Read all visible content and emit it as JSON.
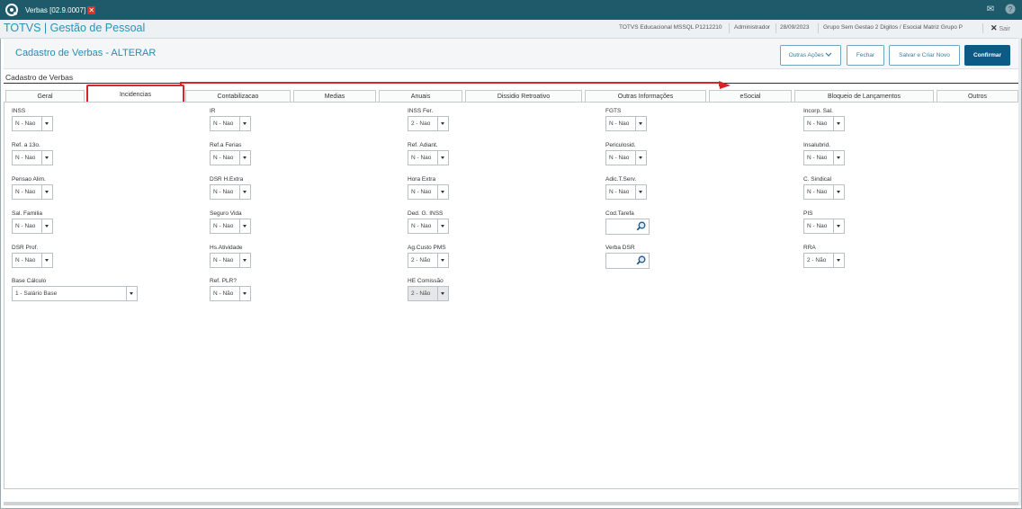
{
  "window": {
    "tab_label": "Verbas [02.9.0007]",
    "close_glyph": "✕"
  },
  "header": {
    "app_title": "TOTVS | Gestão de Pessoal",
    "environment": "TOTVS Educacional MSSQL P1212210",
    "user": "Administrador",
    "date": "28/09/2023",
    "company": "Grupo Sem Gestao 2 Digitos / Esocial Matriz Grupo Pf",
    "exit_label": "Sair"
  },
  "page": {
    "title": "Cadastro de Verbas - ALTERAR",
    "section_title": "Cadastro de Verbas",
    "actions": {
      "more_actions": "Outras Ações",
      "close": "Fechar",
      "save_new": "Salvar e Criar Novo",
      "confirm": "Confirmar"
    }
  },
  "tabs": [
    {
      "label": "Geral"
    },
    {
      "label": "Incidencias"
    },
    {
      "label": "Contabilizacao"
    },
    {
      "label": "Medias"
    },
    {
      "label": "Anuais"
    },
    {
      "label": "Dissidio Retroativo"
    },
    {
      "label": "Outras Informações"
    },
    {
      "label": "eSocial"
    },
    {
      "label": "Bloqueio de Lançamentos"
    },
    {
      "label": "Outros"
    }
  ],
  "fields": {
    "inss": {
      "label": "INSS",
      "value": "N - Nao"
    },
    "ir": {
      "label": "IR",
      "value": "N - Nao"
    },
    "inss_fer": {
      "label": "INSS Fer.",
      "value": "2 - Nao"
    },
    "fgts": {
      "label": "FGTS",
      "value": "N - Nao"
    },
    "incorp_sal": {
      "label": "Incorp. Sal.",
      "value": "N - Nao"
    },
    "ref_13": {
      "label": "Ref. a 13o.",
      "value": "N - Nao"
    },
    "ref_ferias": {
      "label": "Ref.a Ferias",
      "value": "N - Nao"
    },
    "ref_adiant": {
      "label": "Ref. Adiant.",
      "value": "N - Nao"
    },
    "periculosid": {
      "label": "Periculosid.",
      "value": "N - Nao"
    },
    "insalubrid": {
      "label": "Insalubrid.",
      "value": "N - Nao"
    },
    "pensao_alim": {
      "label": "Pensao Alim.",
      "value": "N - Nao"
    },
    "dsr_h_extra": {
      "label": "DSR H.Extra",
      "value": "N - Nao"
    },
    "hora_extra": {
      "label": "Hora Extra",
      "value": "N - Nao"
    },
    "adic_tserv": {
      "label": "Adic.T.Serv.",
      "value": "N - Nao"
    },
    "c_sindical": {
      "label": "C. Sindical",
      "value": "N - Nao"
    },
    "sal_familia": {
      "label": "Sal. Familia",
      "value": "N - Nao"
    },
    "seguro_vida": {
      "label": "Seguro Vida",
      "value": "N - Nao"
    },
    "ded_g_inss": {
      "label": "Ded. G. INSS",
      "value": "N - Nao"
    },
    "cod_tarefa": {
      "label": "Cod.Tarefa",
      "value": ""
    },
    "pis": {
      "label": "PIS",
      "value": "N - Nao"
    },
    "dsr_prof": {
      "label": "DSR Prof.",
      "value": "N - Nao"
    },
    "hs_atividade": {
      "label": "Hs.Atividade",
      "value": "N - Nao"
    },
    "ag_custo_pms": {
      "label": "Ag.Custo PMS",
      "value": "2 - Não"
    },
    "verba_dsr": {
      "label": "Verba DSR",
      "value": ""
    },
    "rra": {
      "label": "RRA",
      "value": "2 - Não"
    },
    "base_calculo": {
      "label": "Base Cálculo",
      "value": "1 - Salário Base"
    },
    "ref_plr": {
      "label": "Ref. PLR?",
      "value": "N - Não"
    },
    "he_comissao": {
      "label": "HE Comissão",
      "value": "2 - Não"
    }
  },
  "colors": {
    "topbar": "#1f5a6b",
    "accent": "#2e8fb8",
    "primary_button": "#0d5a86",
    "highlight": "#d6262a"
  }
}
